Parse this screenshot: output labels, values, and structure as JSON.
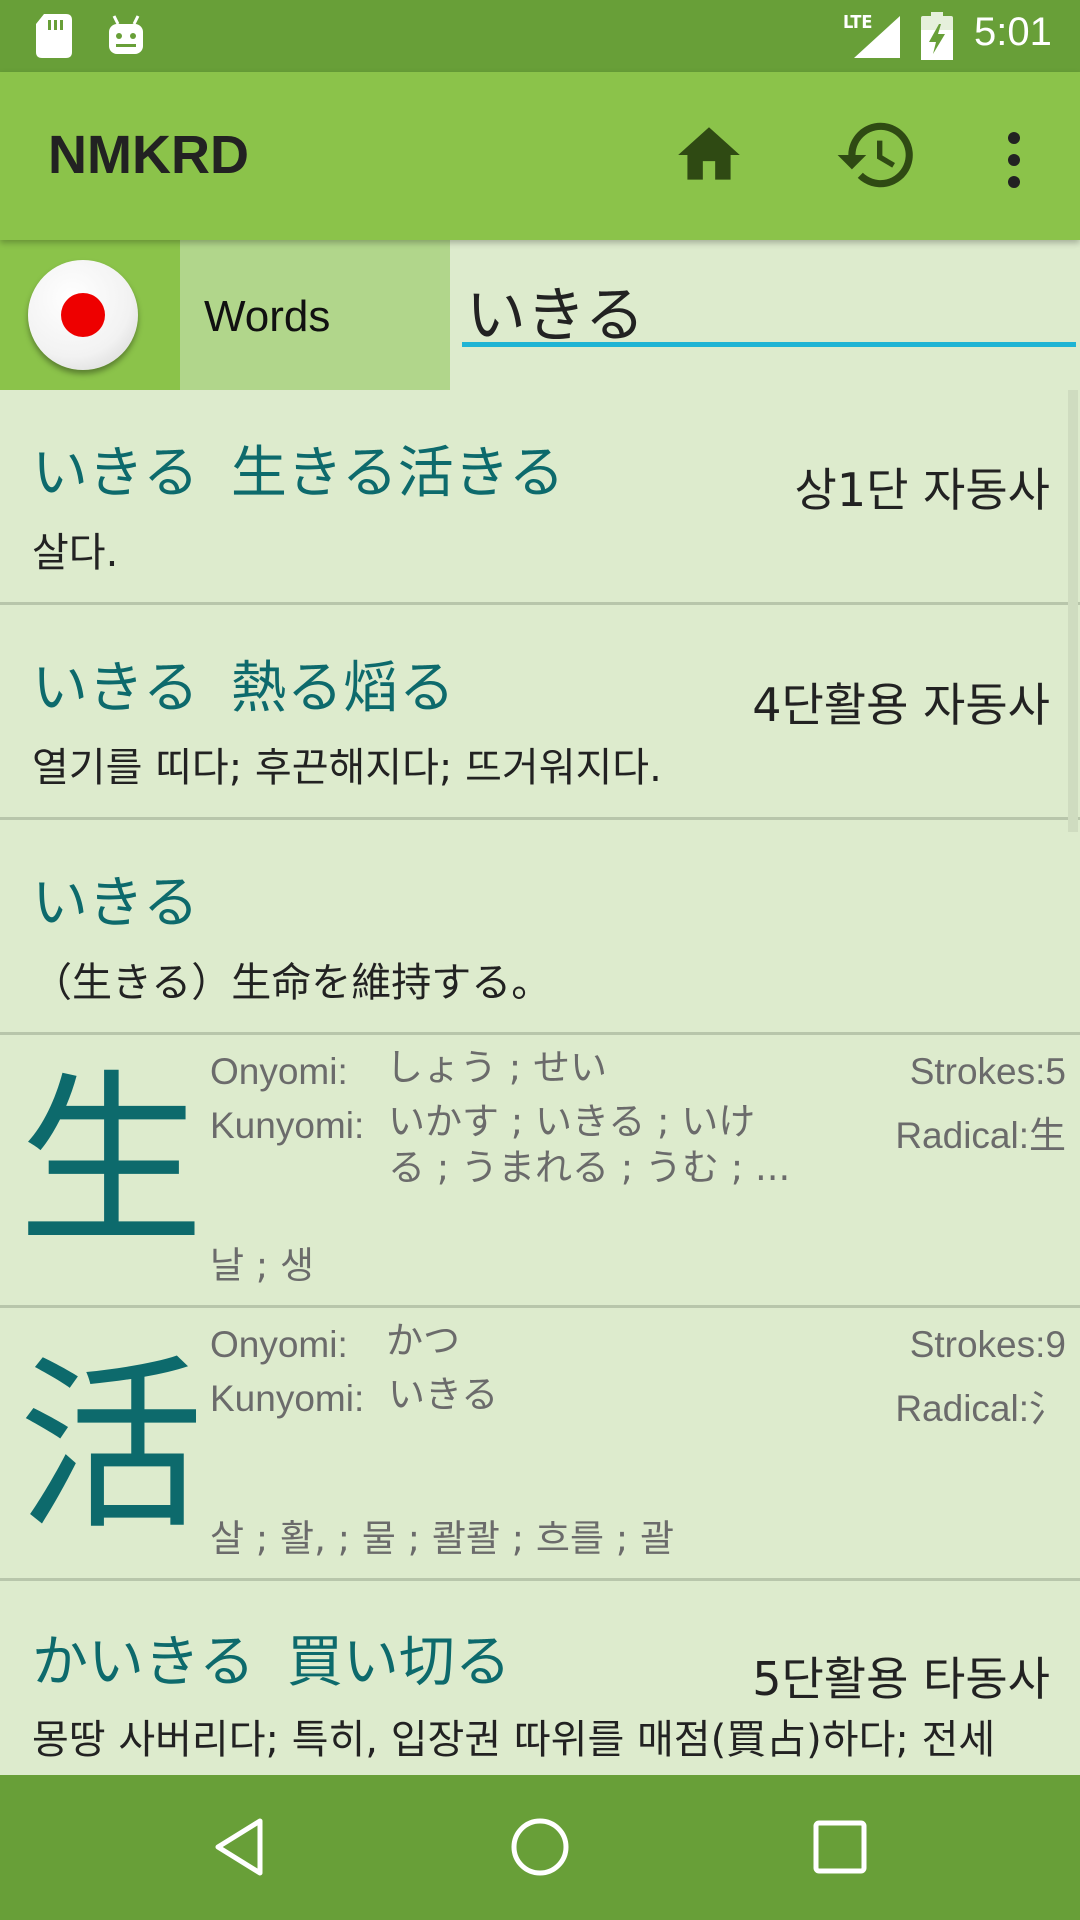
{
  "status_bar": {
    "time": "5:01",
    "network": "LTE"
  },
  "app_bar": {
    "title": "NMKRD"
  },
  "search": {
    "language": "Japanese",
    "mode_label": "Words",
    "query": "いきる"
  },
  "word_results": [
    {
      "reading": "いきる",
      "kanji": "生きる活きる",
      "pos": "상1단 자동사",
      "meaning": "살다."
    },
    {
      "reading": "いきる",
      "kanji": "熱る熖る",
      "pos": "4단활용 자동사",
      "meaning": "열기를 띠다; 후끈해지다; 뜨거워지다."
    },
    {
      "reading": "いきる",
      "kanji": "",
      "pos": "",
      "meaning": "（生きる）生命を維持する。"
    }
  ],
  "kanji_results": [
    {
      "character": "生",
      "onyomi_label": "Onyomi:",
      "onyomi": "しょう ; せい",
      "kunyomi_label": "Kunyomi:",
      "kunyomi_line1": "いかす ; いきる ; いけ",
      "kunyomi_line2": "る ; うまれる ; うむ ; ...",
      "strokes": "Strokes:5",
      "radical": "Radical:生",
      "korean": "날 ; 생"
    },
    {
      "character": "活",
      "onyomi_label": "Onyomi:",
      "onyomi": "かつ",
      "kunyomi_label": "Kunyomi:",
      "kunyomi_line1": "いきる",
      "kunyomi_line2": "",
      "strokes": "Strokes:9",
      "radical": "Radical:氵",
      "korean": "살 ; 활, ; 물 ; 콸콸 ; 흐를 ; 괄"
    }
  ],
  "word_results_2": [
    {
      "reading": "かいきる",
      "kanji": "買い切る",
      "pos": "5단활용 타동사",
      "meaning": "몽땅 사버리다; 특히, 입장권 따위를 매점(買占)하다; 전세"
    }
  ]
}
